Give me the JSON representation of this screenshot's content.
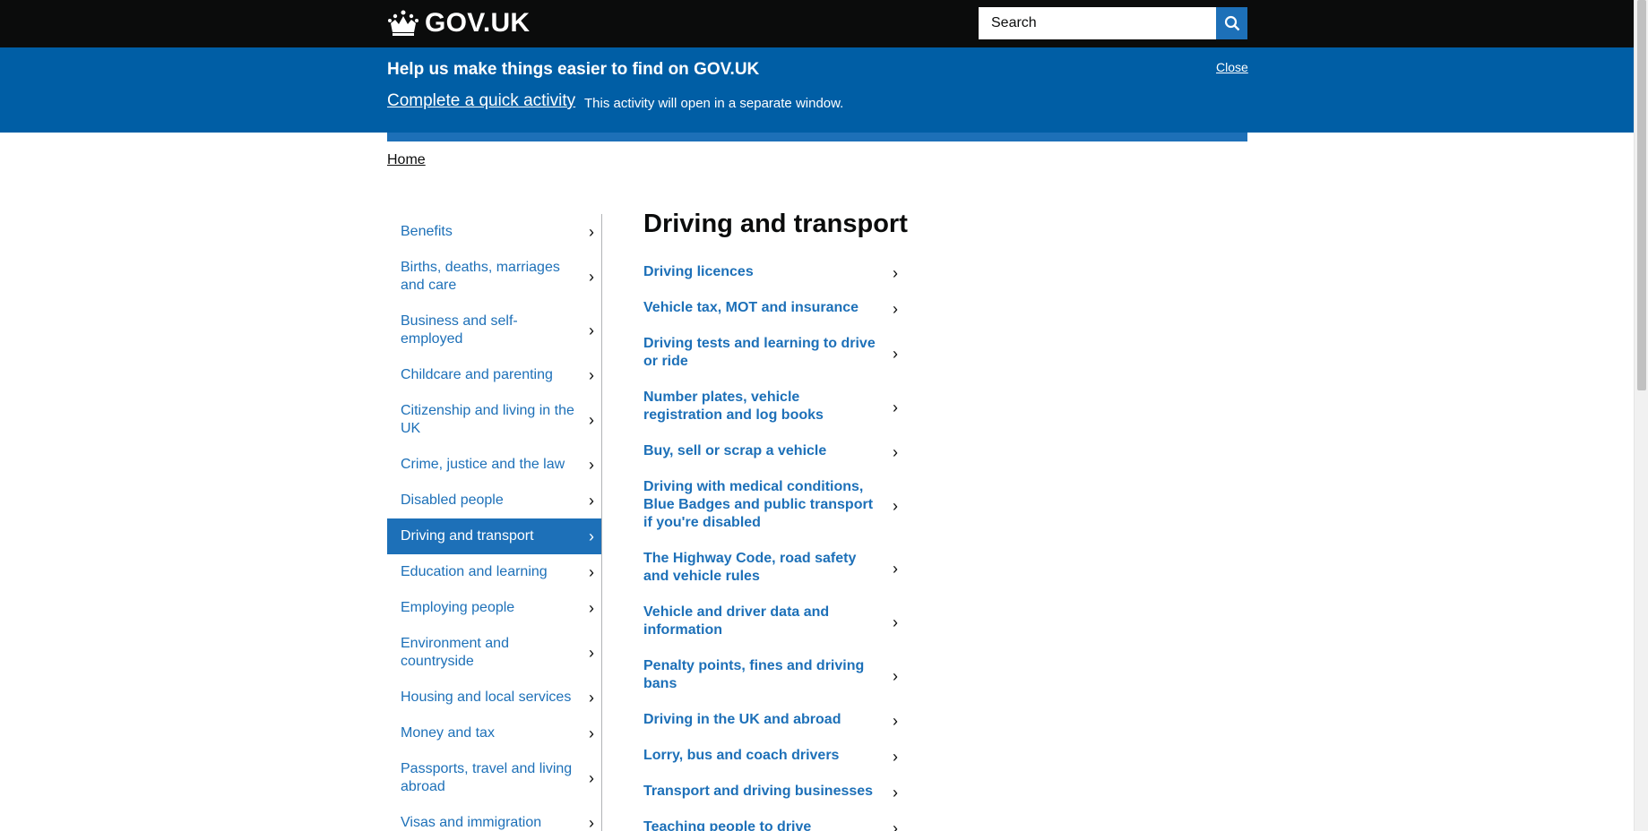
{
  "header": {
    "logo_text": "GOV.UK",
    "search_placeholder": "Search"
  },
  "banner": {
    "title": "Help us make things easier to find on GOV.UK",
    "close_label": "Close",
    "link_text": "Complete a quick activity",
    "note": "This activity will open in a separate window."
  },
  "breadcrumb": {
    "home": "Home"
  },
  "sidebar": {
    "items": [
      {
        "label": "Benefits",
        "active": false
      },
      {
        "label": "Births, deaths, marriages and care",
        "active": false
      },
      {
        "label": "Business and self-employed",
        "active": false
      },
      {
        "label": "Childcare and parenting",
        "active": false
      },
      {
        "label": "Citizenship and living in the UK",
        "active": false
      },
      {
        "label": "Crime, justice and the law",
        "active": false
      },
      {
        "label": "Disabled people",
        "active": false
      },
      {
        "label": "Driving and transport",
        "active": true
      },
      {
        "label": "Education and learning",
        "active": false
      },
      {
        "label": "Employing people",
        "active": false
      },
      {
        "label": "Environment and countryside",
        "active": false
      },
      {
        "label": "Housing and local services",
        "active": false
      },
      {
        "label": "Money and tax",
        "active": false
      },
      {
        "label": "Passports, travel and living abroad",
        "active": false
      },
      {
        "label": "Visas and immigration",
        "active": false
      }
    ],
    "chevron": "›"
  },
  "main": {
    "title": "Driving and transport",
    "topics": [
      "Driving licences",
      "Vehicle tax, MOT and insurance",
      "Driving tests and learning to drive or ride",
      "Number plates, vehicle registration and log books",
      "Buy, sell or scrap a vehicle",
      "Driving with medical conditions, Blue Badges and public transport if you're disabled",
      "The Highway Code, road safety and vehicle rules",
      "Vehicle and driver data and information",
      "Penalty points, fines and driving bans",
      "Driving in the UK and abroad",
      "Lorry, bus and coach drivers",
      "Transport and driving businesses",
      "Teaching people to drive"
    ]
  },
  "colors": {
    "header_bg": "#0b0c0c",
    "banner_bg": "#005ea5",
    "link_blue": "#1d70b8"
  },
  "icons": {
    "logo": "crown-icon",
    "search": "search-icon",
    "chevron": "chevron-right-icon"
  }
}
